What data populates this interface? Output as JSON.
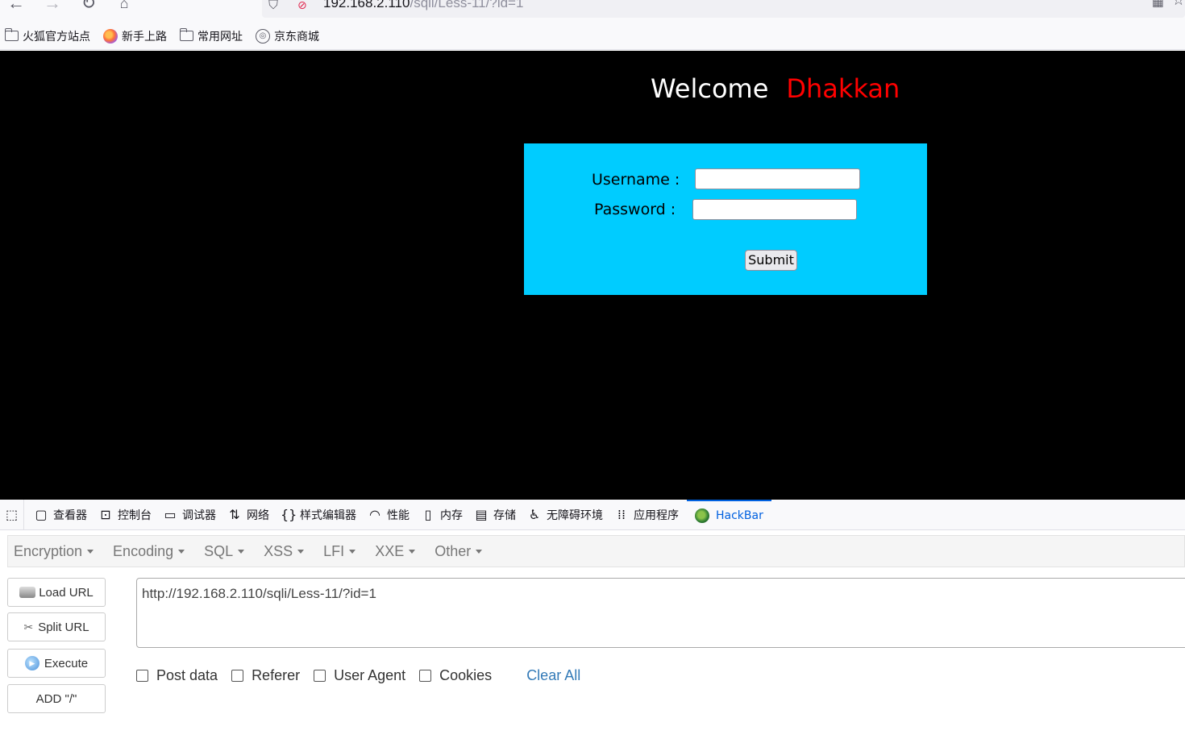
{
  "browser": {
    "url_host": "192.168.2.110",
    "url_path": "/sqli/Less-11/?id=1",
    "bookmarks": [
      "火狐官方站点",
      "新手上路",
      "常用网址",
      "京东商城"
    ]
  },
  "page": {
    "welcome": "Welcome",
    "name": "Dhakkan",
    "username_label": "Username :",
    "password_label": "Password :",
    "username_value": "",
    "password_value": "",
    "submit_label": "Submit"
  },
  "devtools": {
    "tabs": [
      "查看器",
      "控制台",
      "调试器",
      "网络",
      "样式编辑器",
      "性能",
      "内存",
      "存储",
      "无障碍环境",
      "应用程序",
      "HackBar"
    ],
    "active_tab": "HackBar"
  },
  "hackbar": {
    "menus": [
      "Encryption",
      "Encoding",
      "SQL",
      "XSS",
      "LFI",
      "XXE",
      "Other"
    ],
    "load_url": "Load URL",
    "split_url": "Split URL",
    "execute": "Execute",
    "add_slash": "ADD \"/\"",
    "url_value": "http://192.168.2.110/sqli/Less-11/?id=1",
    "options": [
      "Post data",
      "Referer",
      "User Agent",
      "Cookies"
    ],
    "clear_all": "Clear All"
  },
  "colors": {
    "page_bg": "#000000",
    "login_box": "#00ccff",
    "name_color": "#ff0000",
    "active_tab": "#0061e0",
    "link": "#337ab7"
  }
}
